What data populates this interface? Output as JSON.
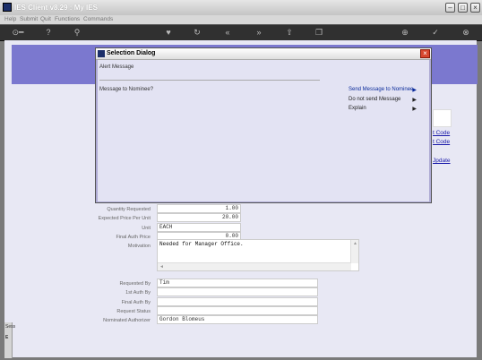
{
  "window": {
    "title": "IES Client v8.29 : My IES"
  },
  "menu": [
    "Help",
    "Submit",
    "Quit",
    "Functions",
    "Commands"
  ],
  "toolbar": {
    "icons": [
      "key-icon",
      "help-icon",
      "search-icon",
      "heart-icon",
      "refresh-icon",
      "back-icon",
      "forward-icon",
      "export-icon",
      "copy-icon",
      "add-icon",
      "check-icon",
      "close-icon"
    ]
  },
  "form": {
    "quantity_label": "Quantity Requested",
    "quantity_value": "1.00",
    "price_label": "Expected Price Per Unit",
    "price_value": "20.00",
    "unit_label": "Unit",
    "unit_value": "EACH",
    "final_price_label": "Final Auth Price",
    "final_price_value": "0.00",
    "motivation_label": "Motivation",
    "motivation_value": "Needed for Manager Office.",
    "requested_by_label": "Requested By",
    "requested_by_value": "Tim",
    "first_auth_label": "1st Auth By",
    "first_auth_value": "",
    "final_auth_label": "Final Auth By",
    "final_auth_value": "",
    "status_label": "Request Status",
    "status_value": "",
    "nominated_label": "Nominated Authorizer",
    "nominated_value": "Gordon Blomeus"
  },
  "right_links": [
    "t Code",
    "t Code",
    "Jpdate"
  ],
  "left_strip": [
    "Sess",
    "E"
  ],
  "dialog": {
    "title": "Selection Dialog",
    "header": "Alert Message",
    "question": "Message to Nominee?",
    "options": [
      "Send Message to Nominee",
      "Do not send Message",
      "Explain"
    ]
  },
  "colors": {
    "banner": "#7b78cf",
    "dialog_frame": "#aeaad4",
    "dialog_body": "#e3e3f3",
    "link": "#1a1aaa"
  }
}
